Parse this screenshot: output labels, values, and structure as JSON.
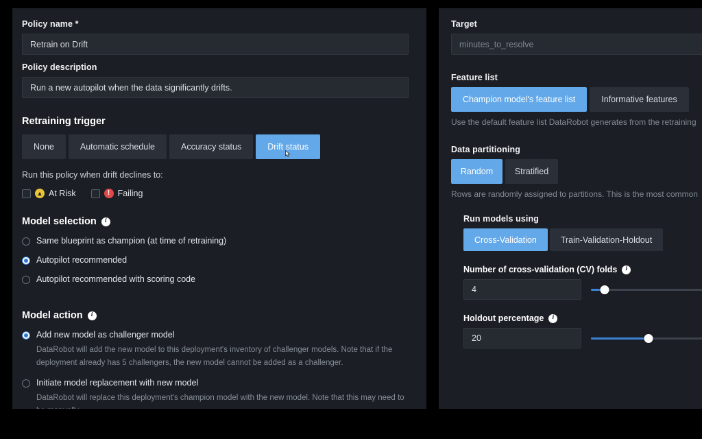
{
  "left_panel": {
    "policy_name": {
      "label": "Policy name *",
      "value": "Retrain on Drift"
    },
    "policy_description": {
      "label": "Policy description",
      "value": "Run a new autopilot when the data significantly drifts."
    },
    "retraining_trigger": {
      "title": "Retraining trigger",
      "options": [
        {
          "label": "None",
          "active": false
        },
        {
          "label": "Automatic schedule",
          "active": false
        },
        {
          "label": "Accuracy status",
          "active": false
        },
        {
          "label": "Drift status",
          "active": true
        }
      ],
      "helper": "Run this policy when drift declines to:",
      "checkboxes": [
        {
          "label": "At Risk",
          "checked": false,
          "status": "warn",
          "glyph": "▲",
          "icon_name": "at-risk-icon"
        },
        {
          "label": "Failing",
          "checked": false,
          "status": "fail",
          "glyph": "!",
          "icon_name": "failing-icon"
        }
      ]
    },
    "model_selection": {
      "title": "Model selection",
      "options": [
        {
          "label": "Same blueprint as champion (at time of retraining)",
          "checked": false
        },
        {
          "label": "Autopilot recommended",
          "checked": true
        },
        {
          "label": "Autopilot recommended with scoring code",
          "checked": false
        }
      ]
    },
    "model_action": {
      "title": "Model action",
      "options": [
        {
          "label": "Add new model as challenger model",
          "checked": true,
          "description": "DataRobot will add the new model to this deployment's inventory of challenger models. Note that if the deployment already has 5 challengers, the new model cannot be added as a challenger."
        },
        {
          "label": "Initiate model replacement with new model",
          "checked": false,
          "description": "DataRobot will replace this deployment's champion model with the new model. Note that this may need to be manually"
        }
      ]
    }
  },
  "right_panel": {
    "target": {
      "label": "Target",
      "value": "minutes_to_resolve"
    },
    "feature_list": {
      "label": "Feature list",
      "options": [
        {
          "label": "Champion model's feature list",
          "active": true
        },
        {
          "label": "Informative features",
          "active": false
        }
      ],
      "hint": "Use the default feature list DataRobot generates from the retraining"
    },
    "data_partitioning": {
      "label": "Data partitioning",
      "options": [
        {
          "label": "Random",
          "active": true
        },
        {
          "label": "Stratified",
          "active": false
        }
      ],
      "hint": "Rows are randomly assigned to partitions. This is the most common"
    },
    "run_models_using": {
      "label": "Run models using",
      "options": [
        {
          "label": "Cross-Validation",
          "active": true
        },
        {
          "label": "Train-Validation-Holdout",
          "active": false
        }
      ]
    },
    "cv_folds": {
      "label": "Number of cross-validation (CV) folds",
      "value": "4",
      "fill_percent": 11
    },
    "holdout_percentage": {
      "label": "Holdout percentage",
      "value": "20",
      "fill_percent": 47
    }
  },
  "colors": {
    "accent": "#63a8e8",
    "slider_accent": "#3b82d6",
    "panel_bg": "#1b1e24",
    "input_bg": "#262a31",
    "warn": "#e8c33c",
    "fail": "#e04a4a"
  }
}
